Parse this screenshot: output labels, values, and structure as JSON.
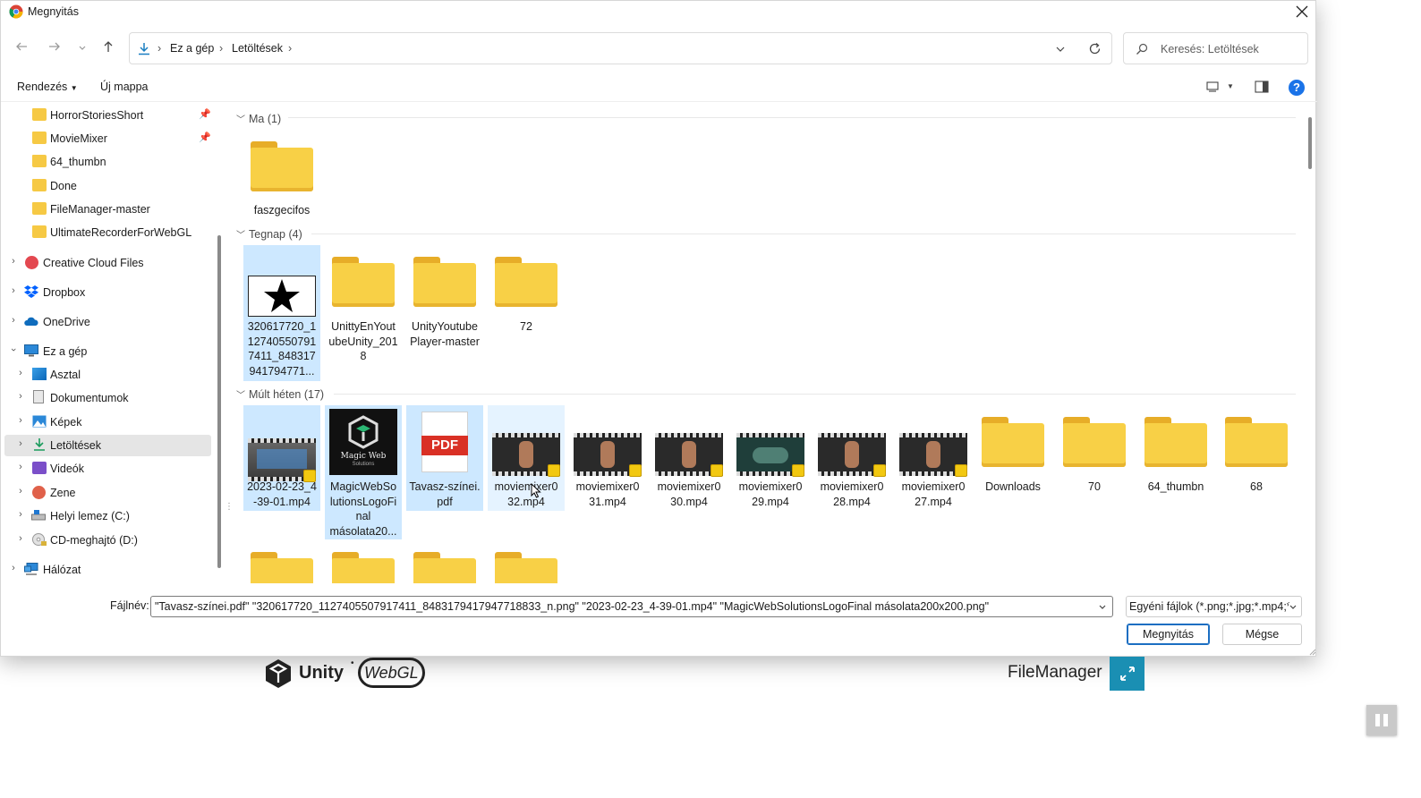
{
  "window": {
    "title": "Megnyitás"
  },
  "address": {
    "crumbs": [
      "Ez a gép",
      "Letöltések"
    ],
    "separator": "›"
  },
  "search": {
    "placeholder": "Keresés: Letöltések"
  },
  "commands": {
    "organize": "Rendezés",
    "new_folder": "Új mappa"
  },
  "nav": {
    "quick": [
      "HorrorStoriesShort",
      "MovieMixer",
      "64_thumbn",
      "Done",
      "FileManager-master",
      "UltimateRecorderForWebGL"
    ],
    "roots": [
      {
        "label": "Creative Cloud Files",
        "icon": "creative-cloud-icon"
      },
      {
        "label": "Dropbox",
        "icon": "dropbox-icon"
      },
      {
        "label": "OneDrive",
        "icon": "onedrive-cloud-icon"
      },
      {
        "label": "Ez a gép",
        "icon": "computer-icon"
      }
    ],
    "pc_children": [
      {
        "label": "Asztal",
        "icon": "desktop-icon"
      },
      {
        "label": "Dokumentumok",
        "icon": "documents-icon"
      },
      {
        "label": "Képek",
        "icon": "pictures-icon"
      },
      {
        "label": "Letöltések",
        "icon": "download-arrow-icon"
      },
      {
        "label": "Videók",
        "icon": "videos-icon"
      },
      {
        "label": "Zene",
        "icon": "music-icon"
      },
      {
        "label": "Helyi lemez (C:)",
        "icon": "drive-icon"
      },
      {
        "label": "CD-meghajtó (D:)",
        "icon": "cd-drive-icon"
      }
    ],
    "network": {
      "label": "Hálózat",
      "icon": "network-icon"
    }
  },
  "groups": {
    "today": {
      "header": "Ma (1)",
      "items": [
        "faszgecifos"
      ]
    },
    "yesterday": {
      "header": "Tegnap (4)",
      "items": [
        {
          "lines": [
            "320617720_1",
            "12740550791",
            "7411_848317",
            "941794771..."
          ]
        },
        {
          "lines": [
            "UnittyEnYout",
            "ubeUnity_201",
            "8"
          ]
        },
        {
          "lines": [
            "UnityYoutube",
            "Player-master"
          ]
        },
        {
          "lines": [
            "72"
          ]
        }
      ]
    },
    "last_week": {
      "header": "Múlt héten (17)",
      "items": [
        {
          "lines": [
            "2023-02-23_4",
            "-39-01.mp4"
          ]
        },
        {
          "lines": [
            "MagicWebSo",
            "lutionsLogoFi",
            "nal",
            "másolata20..."
          ]
        },
        {
          "lines": [
            "Tavasz-színei.",
            "pdf"
          ]
        },
        {
          "lines": [
            "moviemixer0",
            "32.mp4"
          ]
        },
        {
          "lines": [
            "moviemixer0",
            "31.mp4"
          ]
        },
        {
          "lines": [
            "moviemixer0",
            "30.mp4"
          ]
        },
        {
          "lines": [
            "moviemixer0",
            "29.mp4"
          ]
        },
        {
          "lines": [
            "moviemixer0",
            "28.mp4"
          ]
        },
        {
          "lines": [
            "moviemixer0",
            "27.mp4"
          ]
        },
        {
          "lines": [
            "Downloads"
          ]
        },
        {
          "lines": [
            "70"
          ]
        },
        {
          "lines": [
            "64_thumbn"
          ]
        },
        {
          "lines": [
            "68"
          ]
        }
      ]
    }
  },
  "thumb_text": {
    "pdf": "PDF",
    "magic1": "Magic Web",
    "magic2": "Solutions"
  },
  "footer": {
    "filename_label": "Fájlnév:",
    "filename_value": "\"Tavasz-színei.pdf\" \"320617720_1127405507917411_8483179417947718833_n.png\" \"2023-02-23_4-39-01.mp4\" \"MagicWebSolutionsLogoFinal másolata200x200.png\"",
    "filetype_value": "Egyéni fájlok (*.png;*.jpg;*.mp4;*",
    "open_button": "Megnyitás",
    "cancel_button": "Mégse"
  },
  "underlying": {
    "unity_text": "Unity",
    "webgl_text": "WebGL",
    "filemanager_label": "FileManager"
  },
  "colors": {
    "accent": "#1b6ec2",
    "selection": "#cde8ff",
    "folder": "#f8d046",
    "help": "#1a73e8",
    "fullscreen": "#1a8fb3"
  }
}
